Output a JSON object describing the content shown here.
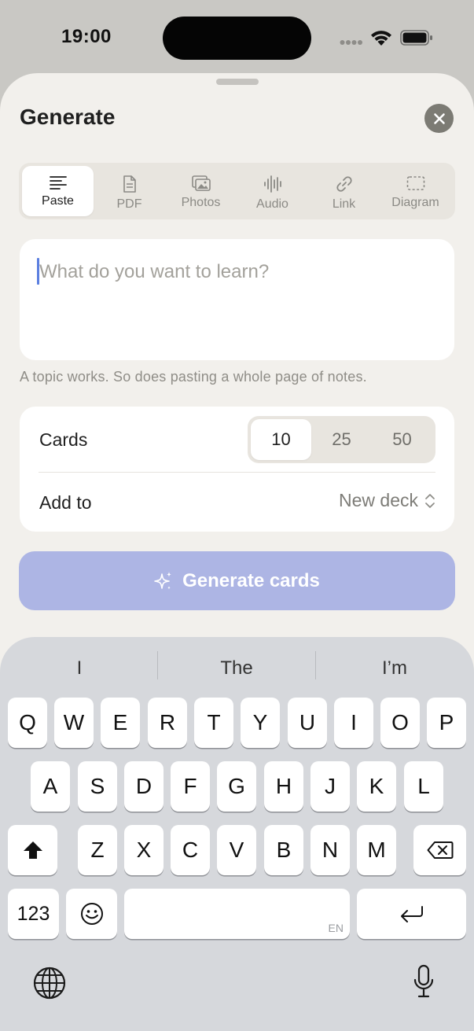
{
  "status_bar": {
    "time": "19:00"
  },
  "sheet": {
    "title": "Generate",
    "source_tabs": [
      {
        "label": "Paste",
        "icon": "text-lines-icon",
        "active": true
      },
      {
        "label": "PDF",
        "icon": "document-icon",
        "active": false
      },
      {
        "label": "Photos",
        "icon": "photos-icon",
        "active": false
      },
      {
        "label": "Audio",
        "icon": "waveform-icon",
        "active": false
      },
      {
        "label": "Link",
        "icon": "link-icon",
        "active": false
      },
      {
        "label": "Diagram",
        "icon": "dashed-rect-icon",
        "active": false
      }
    ],
    "input": {
      "placeholder": "What do you want to learn?",
      "value": ""
    },
    "hint": "A topic works. So does pasting a whole page of notes.",
    "cards": {
      "label": "Cards",
      "options": [
        "10",
        "25",
        "50"
      ],
      "selected": "10"
    },
    "add_to": {
      "label": "Add to",
      "value": "New deck"
    },
    "generate_button": "Generate cards"
  },
  "keyboard": {
    "suggestions": [
      "I",
      "The",
      "I’m"
    ],
    "row1": [
      "Q",
      "W",
      "E",
      "R",
      "T",
      "Y",
      "U",
      "I",
      "O",
      "P"
    ],
    "row2": [
      "A",
      "S",
      "D",
      "F",
      "G",
      "H",
      "J",
      "K",
      "L"
    ],
    "row3": [
      "Z",
      "X",
      "C",
      "V",
      "B",
      "N",
      "M"
    ],
    "numbers_key": "123",
    "space_language": "EN"
  },
  "colors": {
    "sheet_background": "#f2f0ec",
    "accent_button": "#adb5e4",
    "caret": "#5b7fe0",
    "close_button": "#7c7b74"
  }
}
